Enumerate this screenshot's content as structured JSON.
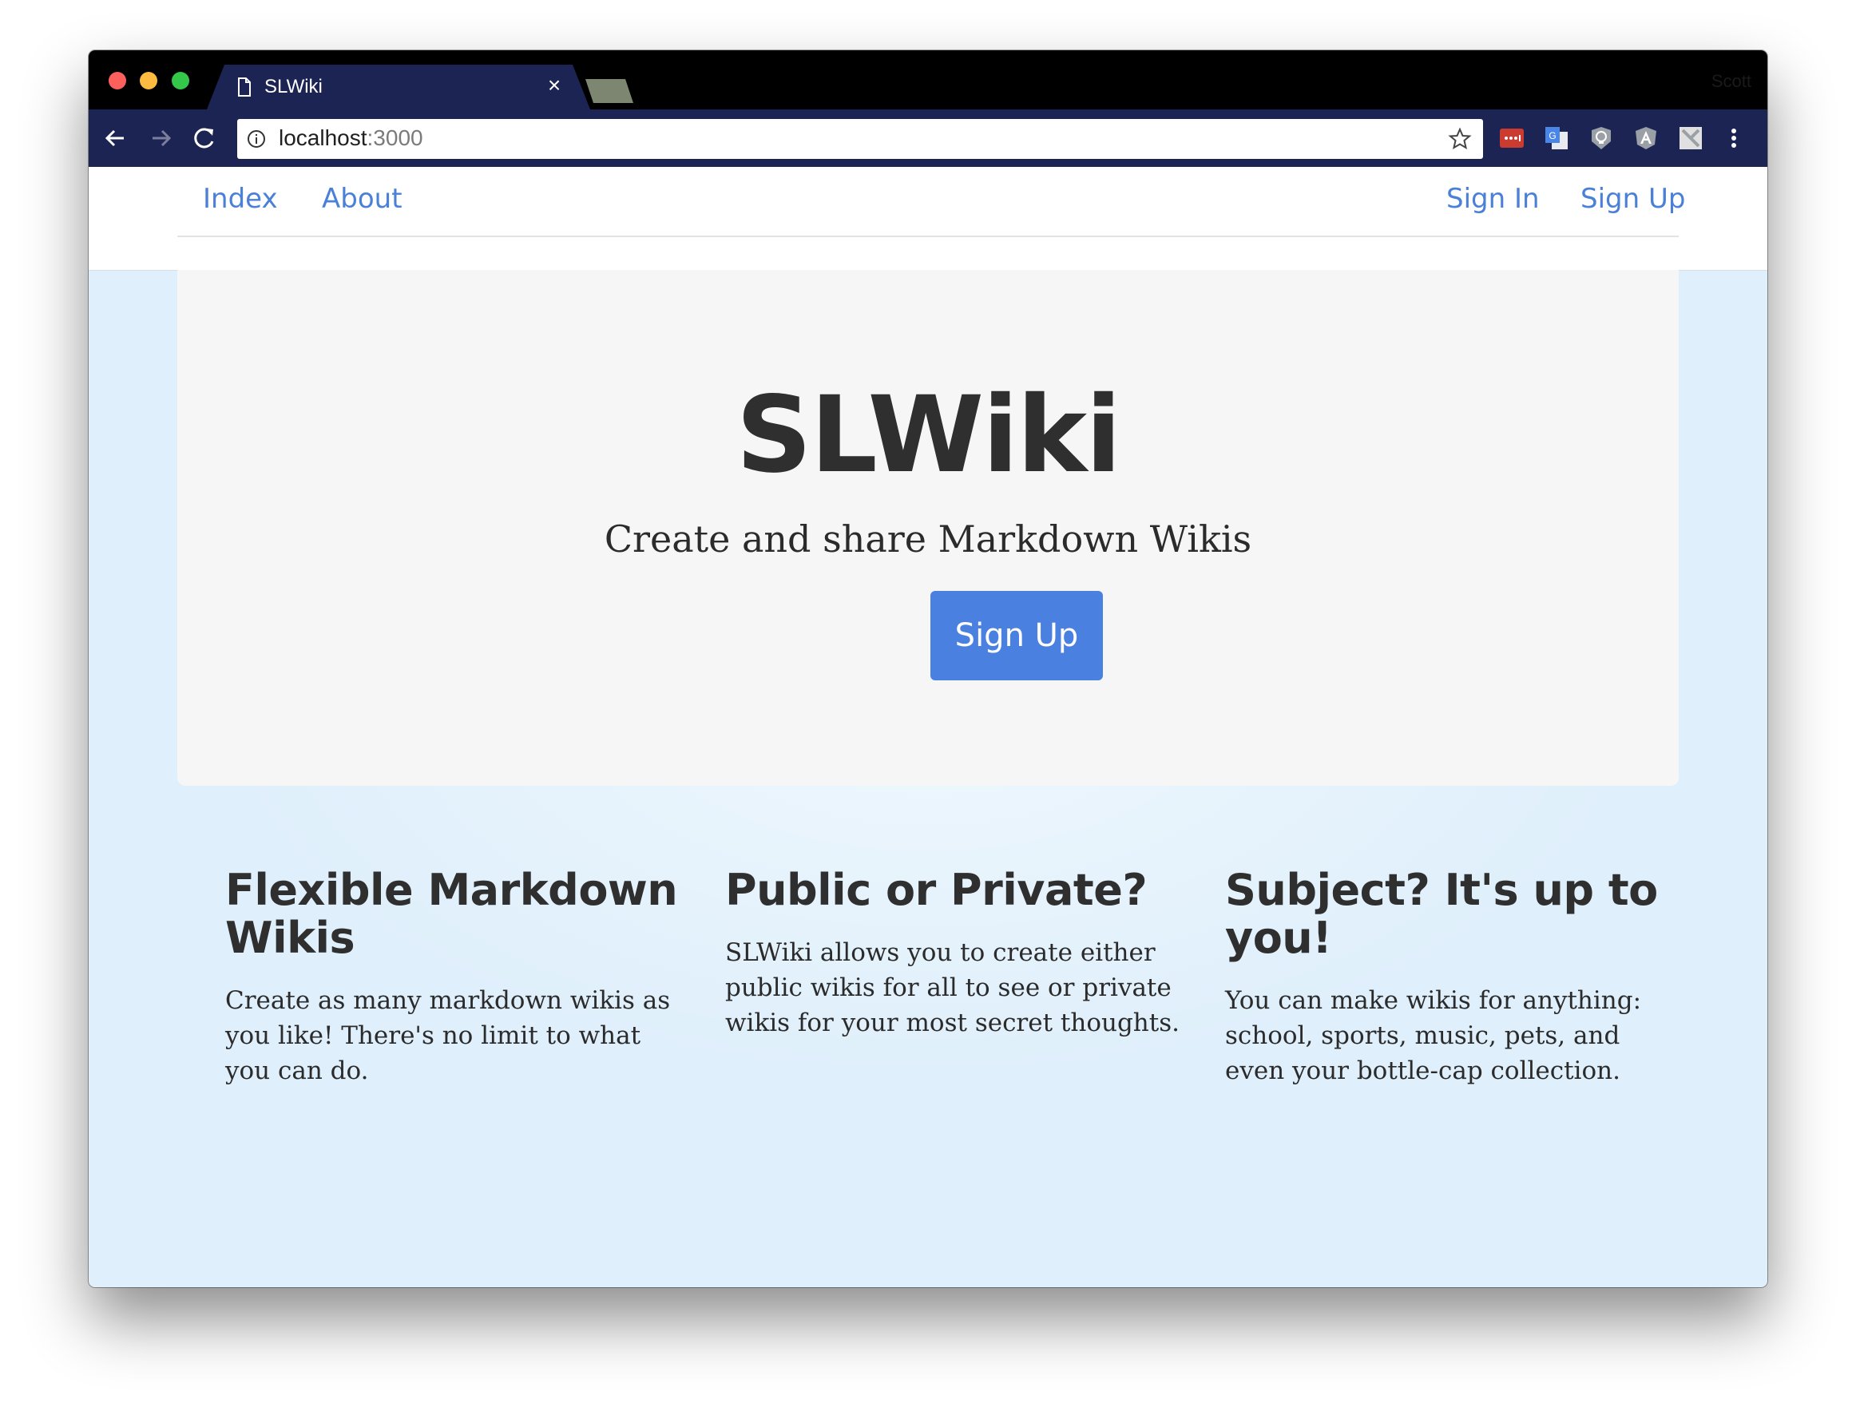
{
  "browser": {
    "tab_title": "SLWiki",
    "tab_close": "×",
    "profile_name": "Scott",
    "url_host": "localhost",
    "url_port": ":3000",
    "icons": [
      "back-arrow-icon",
      "forward-arrow-icon",
      "reload-icon",
      "info-icon",
      "star-icon",
      "page-icon"
    ],
    "extensions": [
      "lastpass-extension-icon",
      "google-translate-extension-icon",
      "lightbulb-extension-icon",
      "angular-extension-icon",
      "puzzle-extension-icon",
      "menu-dots-icon"
    ]
  },
  "navbar": {
    "left_links": [
      "Index",
      "About"
    ],
    "right_links": [
      "Sign In",
      "Sign Up"
    ]
  },
  "hero": {
    "title": "SLWiki",
    "subtitle": "Create and share Markdown Wikis",
    "button": "Sign Up",
    "button_color": "#4a80e0"
  },
  "features": [
    {
      "title": "Flexible Markdown Wikis",
      "text": "Create as many markdown wikis as you like! There's no limit to what you can do."
    },
    {
      "title": "Public or Private?",
      "text": "SLWiki allows you to create either public wikis for all to see or private wikis for your most secret thoughts."
    },
    {
      "title": "Subject? It's up to you!",
      "text": "You can make wikis for anything: school, sports, music, pets, and even your bottle-cap collection."
    }
  ],
  "colors": {
    "link": "#4a80d8",
    "toolbar": "#1c2453",
    "page_bg": "#dfeffb"
  }
}
